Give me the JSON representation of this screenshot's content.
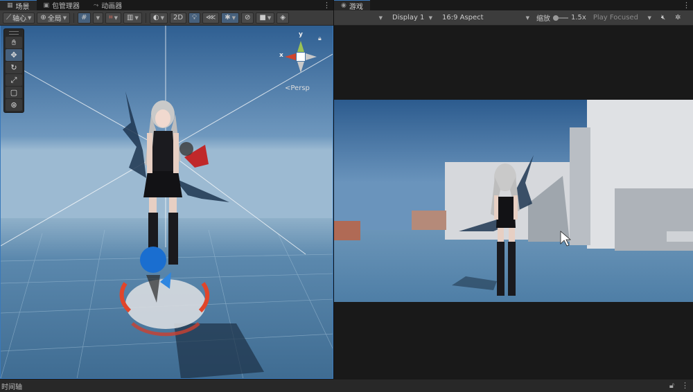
{
  "scene_panel": {
    "tab_label": "场景",
    "tab2_label": "包管理器",
    "tab3_label": "动画器",
    "pivot_label": "轴心",
    "global_label": "全局",
    "mode_2d_label": "2D",
    "persp_label": "<Persp",
    "gizmo": {
      "x": "x",
      "y": "y"
    },
    "tools": [
      "hand-icon",
      "move-icon",
      "rotate-icon",
      "scale-icon",
      "rect-icon",
      "transform-icon"
    ]
  },
  "game_panel": {
    "tab_label": "游戏",
    "display_label": "Display 1",
    "aspect_label": "16:9 Aspect",
    "scale_label": "缩放",
    "scale_value": "1.5x",
    "play_mode_label": "Play Focused"
  },
  "status_bar": {
    "timeline_label": "时间轴"
  },
  "colors": {
    "accent": "#3a79bb",
    "sky_top": "#4a78ab",
    "ground": "#5b85a8",
    "panel_bg": "#191919"
  }
}
